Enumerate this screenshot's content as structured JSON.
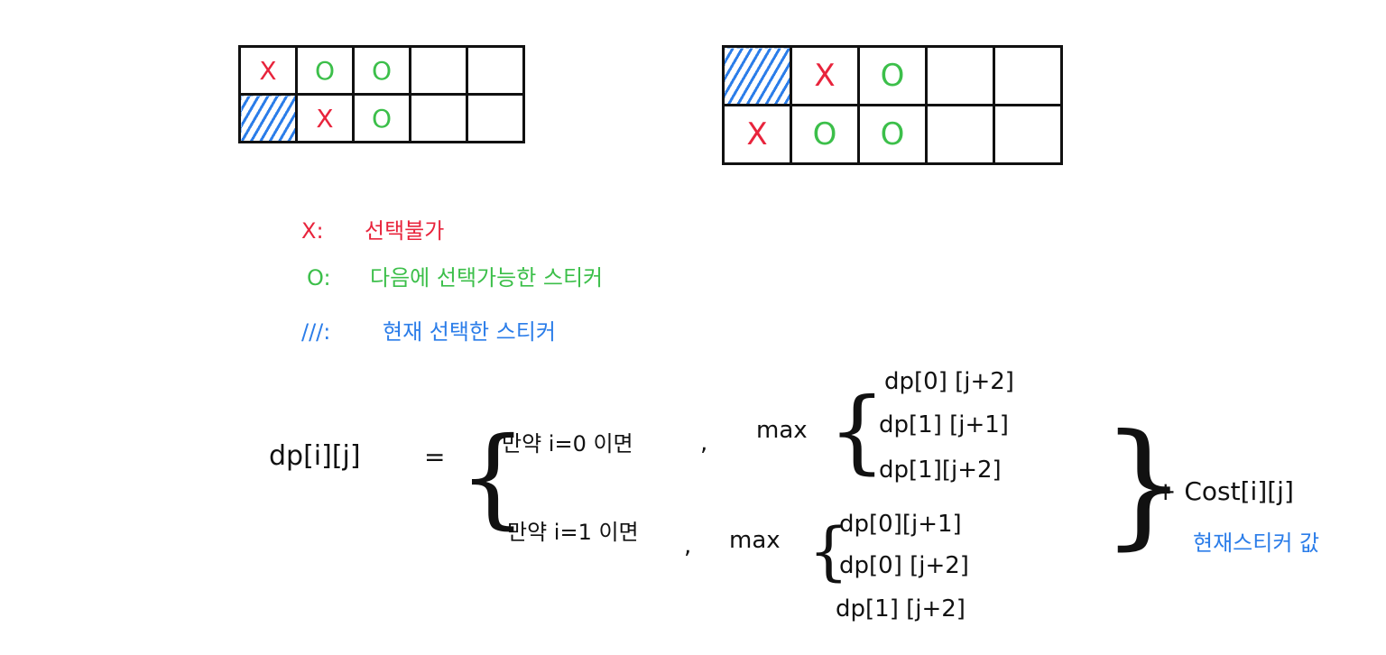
{
  "grid_left": {
    "rows": [
      [
        "X",
        "O",
        "O",
        "",
        ""
      ],
      [
        "",
        "X",
        "O",
        "",
        ""
      ]
    ]
  },
  "grid_right": {
    "rows": [
      [
        "",
        "X",
        "O",
        "",
        ""
      ],
      [
        "X",
        "O",
        "O",
        "",
        ""
      ]
    ]
  },
  "legend": {
    "x_symbol": "X:",
    "x_text": "선택불가",
    "o_symbol": "O:",
    "o_text": "다음에 선택가능한 스티커",
    "hatch_symbol": "///:",
    "hatch_text": "현재 선택한 스티커"
  },
  "formula": {
    "lhs": "dp[i][j]",
    "equals": "=",
    "case1_cond": "만약 i=0 이면",
    "case1_comma": ",",
    "case1_max": "max",
    "case1_terms": [
      "dp[0] [j+2]",
      "dp[1] [j+1]",
      "dp[1][j+2]"
    ],
    "case2_cond": "만약 i=1 이면",
    "case2_comma": ",",
    "case2_max": "max",
    "case2_terms": [
      "dp[0][j+1]",
      "dp[0] [j+2]",
      "dp[1] [j+2]"
    ],
    "plus_cost": "+ Cost[i][j]",
    "cost_note": "현재스티커 값"
  },
  "colors": {
    "x_mark": "#e8243c",
    "o_mark": "#3cbf4a",
    "hatch": "#2b7de9",
    "ink": "#111111"
  }
}
